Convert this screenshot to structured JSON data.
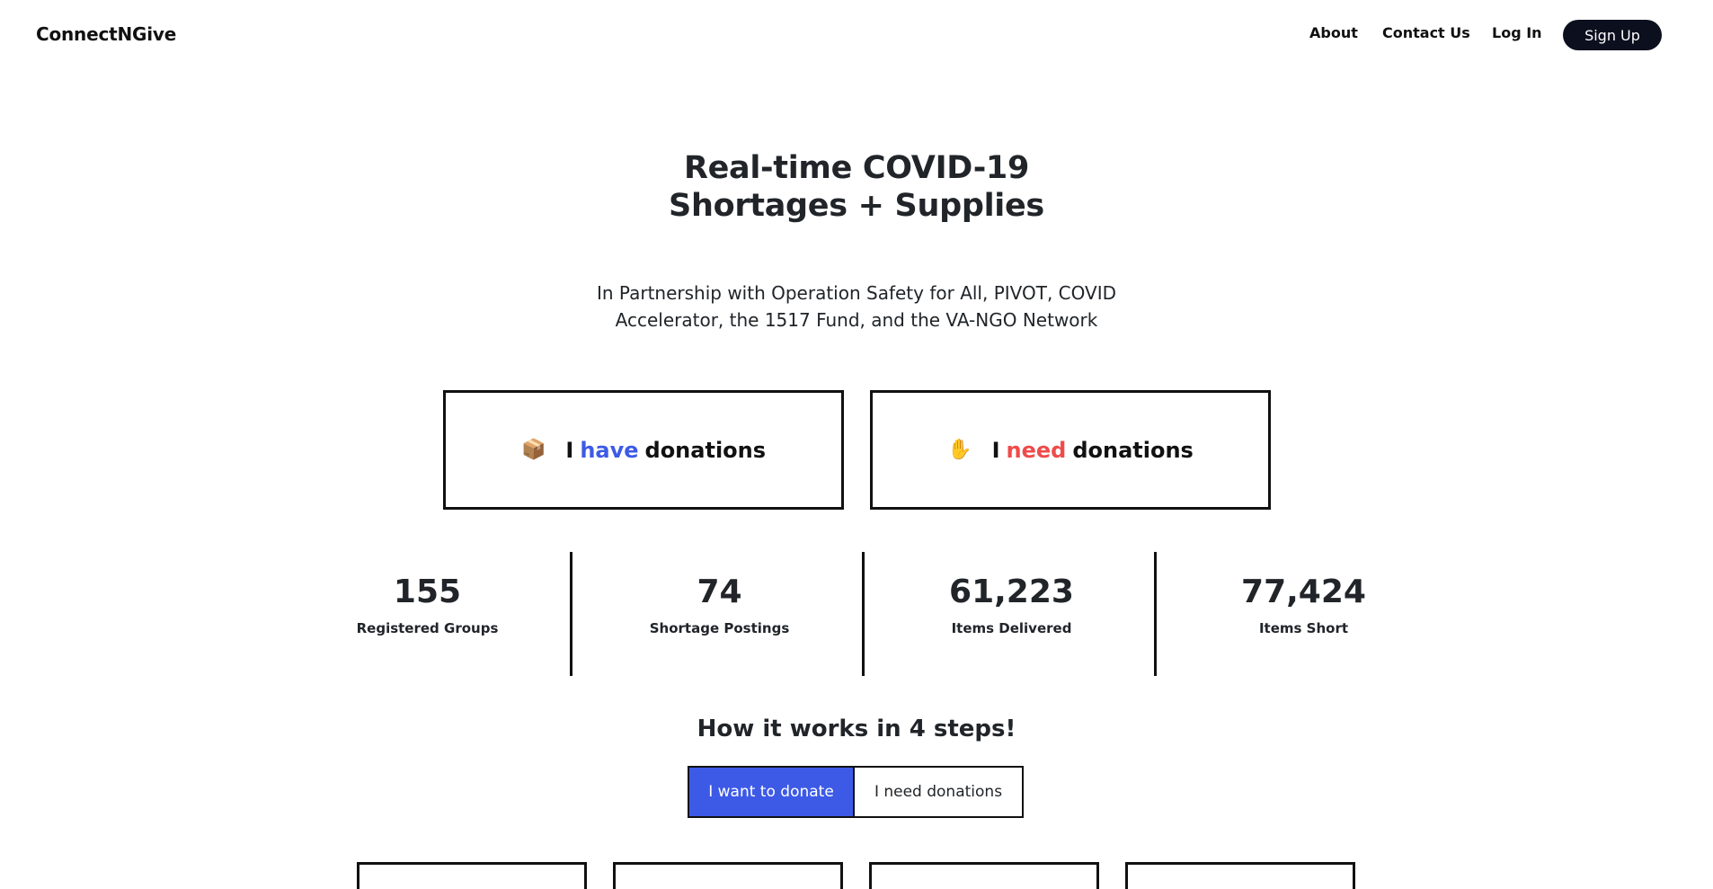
{
  "nav": {
    "brand": "ConnectNGive",
    "about": "About",
    "contact": "Contact Us",
    "login": "Log In",
    "signup": "Sign Up"
  },
  "hero": {
    "title_line1": "Real-time COVID-19",
    "title_line2": "Shortages + Supplies",
    "partnership_line1": "In Partnership with Operation Safety for All, PIVOT, COVID",
    "partnership_line2": "Accelerator, the 1517 Fund, and the VA-NGO Network"
  },
  "cta": {
    "have": {
      "icon": "📦",
      "icon_name": "package-icon",
      "word1": "I",
      "word2": "have",
      "word3": "donations",
      "accent_color": "#3d5ae6"
    },
    "need": {
      "icon": "✋",
      "icon_name": "raised-hand-icon",
      "word1": "I",
      "word2": "need",
      "word3": "donations",
      "accent_color": "#ef4b4b"
    }
  },
  "stats": [
    {
      "value": "155",
      "label": "Registered Groups"
    },
    {
      "value": "74",
      "label": "Shortage Postings"
    },
    {
      "value": "61,223",
      "label": "Items Delivered"
    },
    {
      "value": "77,424",
      "label": "Items Short"
    }
  ],
  "how": {
    "title": "How it works in 4 steps!",
    "toggle_donate": "I want to donate",
    "toggle_need": "I need donations",
    "active": "I want to donate",
    "active_color": "#3d5ae6"
  }
}
